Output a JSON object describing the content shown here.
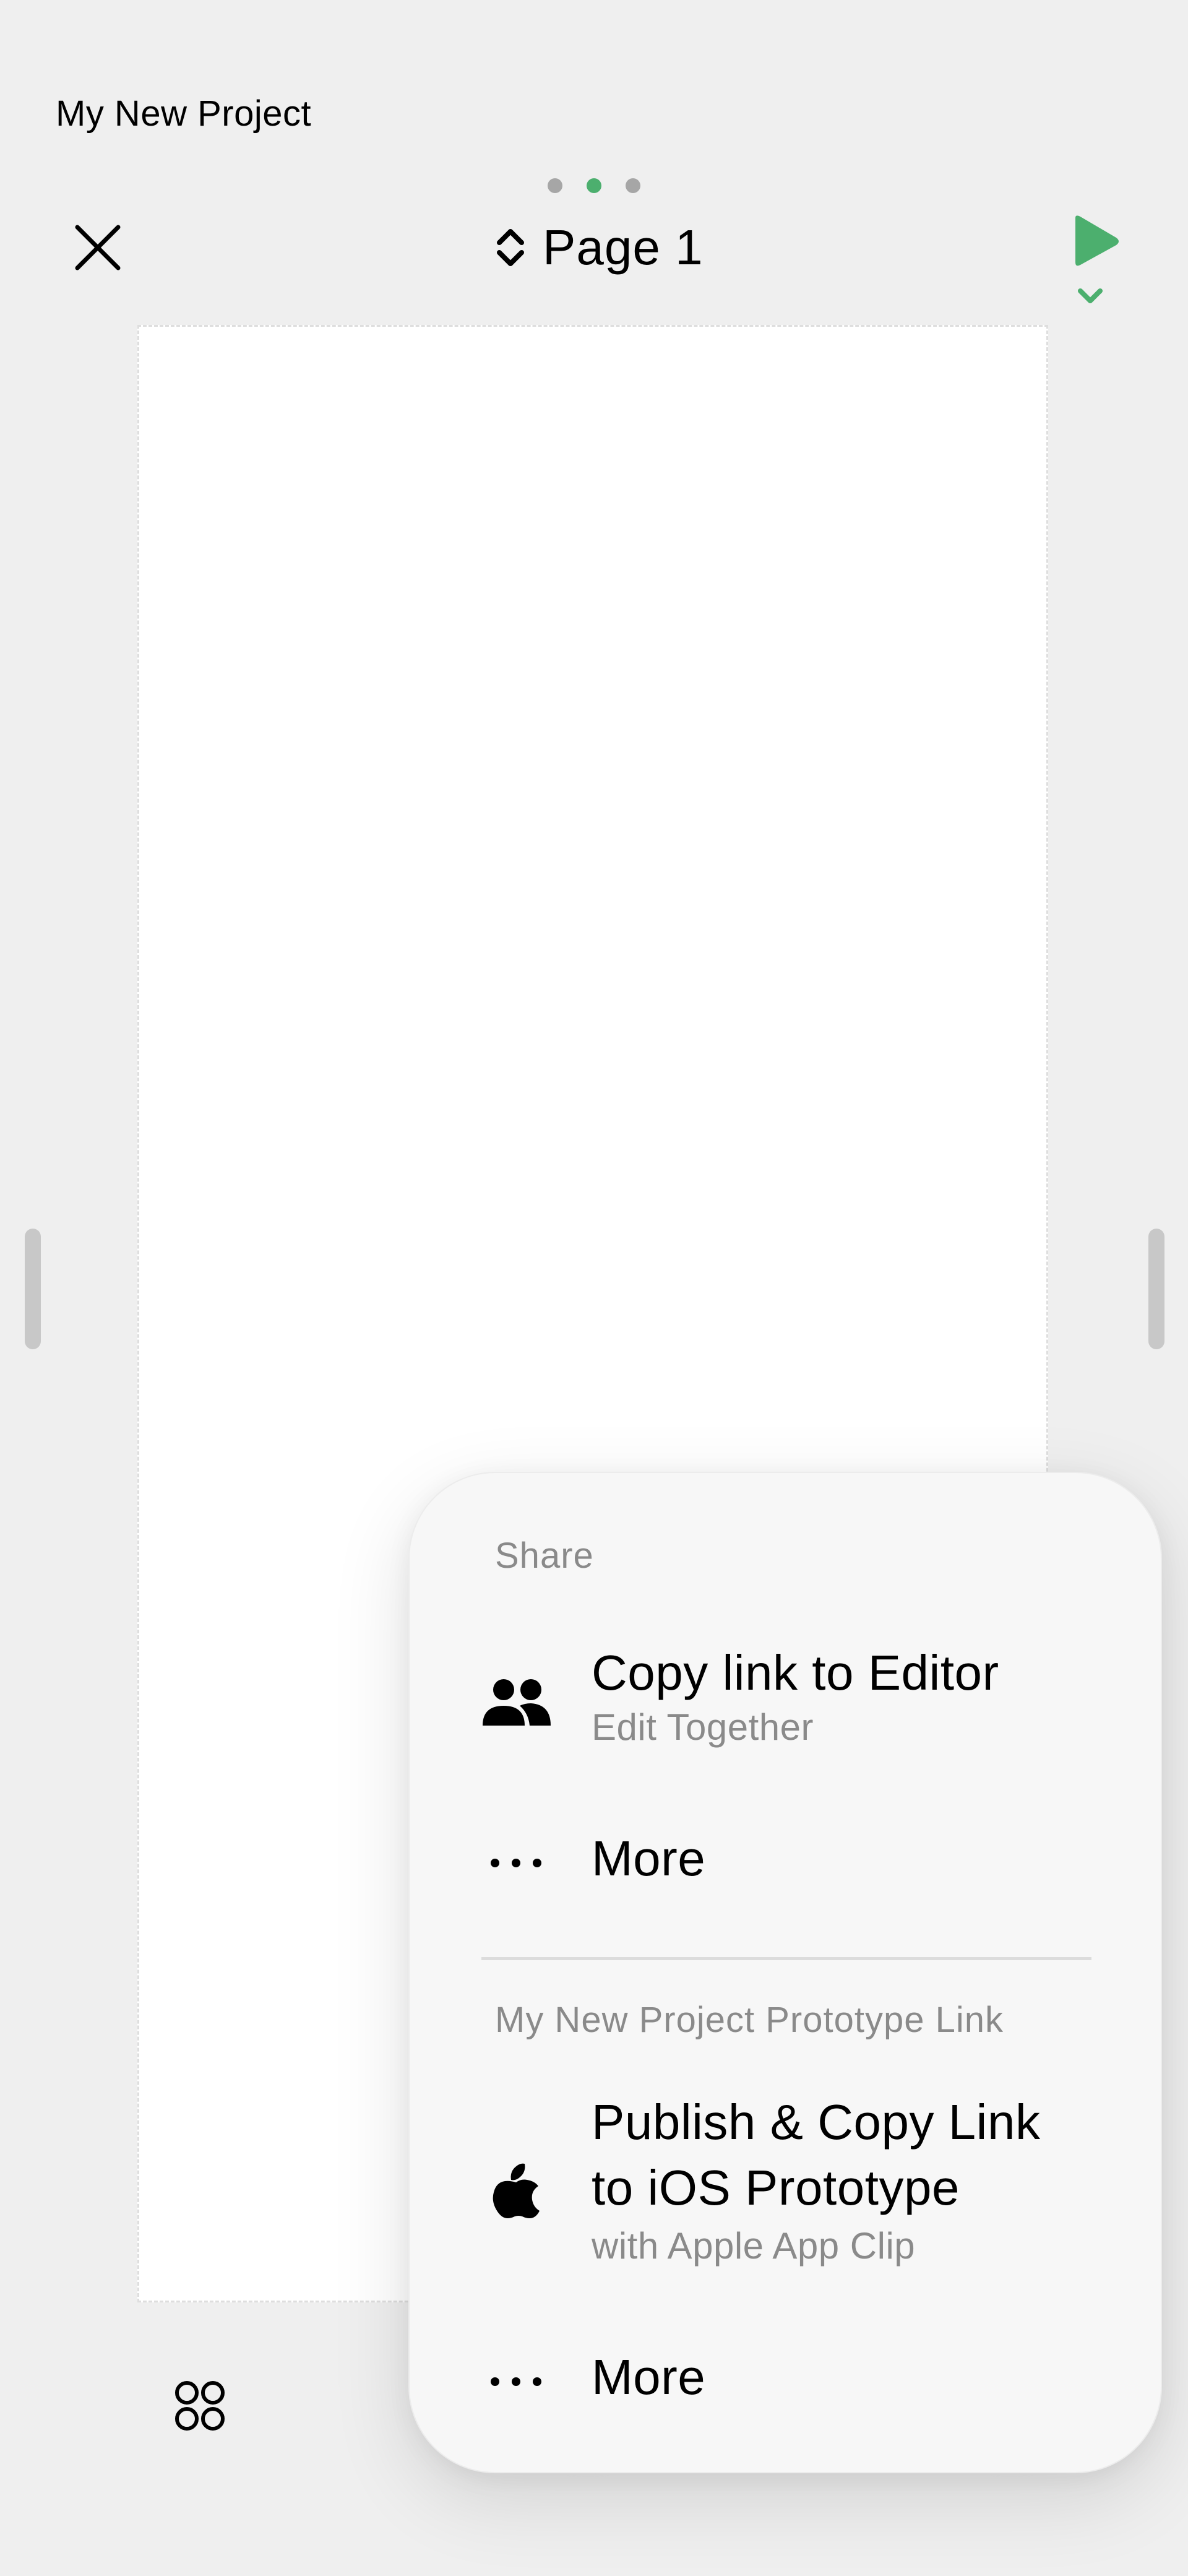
{
  "project": {
    "title": "My New Project"
  },
  "header": {
    "page_label": "Page 1",
    "dots": [
      {
        "color": "#a6a6a6",
        "active": false
      },
      {
        "color": "#4caf6e",
        "active": true
      },
      {
        "color": "#a6a6a6",
        "active": false
      }
    ],
    "close_icon": "close-icon",
    "page_selector_icon": "chevron-up-down-icon",
    "play_icon": "play-icon",
    "accent_color": "#4caf6e"
  },
  "share_menu": {
    "section_share": "Share",
    "items_share": [
      {
        "icon": "people-icon",
        "title": "Copy link to Editor",
        "subtitle": "Edit Together"
      },
      {
        "icon": "ellipsis-icon",
        "title": "More"
      }
    ],
    "section_prototype": "My New Project Prototype Link",
    "items_prototype": [
      {
        "icon": "apple-icon",
        "title_line1": "Publish & Copy Link",
        "title_line2": "to iOS Prototype",
        "subtitle": "with Apple App Clip"
      },
      {
        "icon": "ellipsis-icon",
        "title": "More"
      }
    ]
  },
  "bottom_bar": {
    "left_icon": "grid-circles-icon"
  }
}
